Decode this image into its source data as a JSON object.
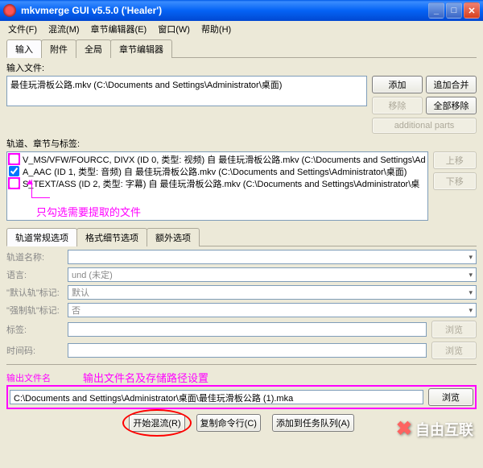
{
  "window": {
    "title": "mkvmerge GUI v5.5.0 ('Healer')"
  },
  "menu": {
    "file": "文件(F)",
    "mux": "混流(M)",
    "chaptereditor": "章节编辑器(E)",
    "window": "窗口(W)",
    "help": "帮助(H)"
  },
  "maintabs": {
    "input": "输入",
    "attach": "附件",
    "global": "全局",
    "chapter": "章节编辑器"
  },
  "input": {
    "files_label": "输入文件:",
    "file0": "最佳玩滑板公路.mkv (C:\\Documents and Settings\\Administrator\\桌面)",
    "btn_add": "添加",
    "btn_append": "追加合并",
    "btn_remove": "移除",
    "btn_removeall": "全部移除",
    "btn_additional": "additional parts",
    "tracks_label": "轨道、章节与标签:",
    "track0": "V_MS/VFW/FOURCC, DIVX (ID 0, 类型: 视频) 自 最佳玩滑板公路.mkv (C:\\Documents and Settings\\Ad",
    "track1": "A_AAC (ID 1, 类型: 音频) 自 最佳玩滑板公路.mkv (C:\\Documents and Settings\\Administrator\\桌面)",
    "track2": "S_TEXT/ASS (ID 2, 类型: 字幕) 自 最佳玩滑板公路.mkv (C:\\Documents and Settings\\Administrator\\桌",
    "btn_up": "上移",
    "btn_down": "下移",
    "annotation1": "只勾选需要提取的文件"
  },
  "subtabs": {
    "general": "轨道常规选项",
    "format": "格式细节选项",
    "extra": "额外选项"
  },
  "fields": {
    "trackname_label": "轨道名称:",
    "trackname_val": "",
    "language_label": "语言:",
    "language_val": "und (未定)",
    "default_label": "\"默认轨\"标记:",
    "default_val": "默认",
    "forced_label": "\"强制轨\"标记:",
    "forced_val": "否",
    "tags_label": "标签:",
    "tags_val": "",
    "timecodes_label": "时间码:",
    "timecodes_val": "",
    "browse": "浏览"
  },
  "output": {
    "label": "输出文件名",
    "annotation": "输出文件名及存储路径设置",
    "path": "C:\\Documents and Settings\\Administrator\\桌面\\最佳玩滑板公路 (1).mka",
    "browse": "浏览"
  },
  "footer": {
    "start": "开始混流(R)",
    "copy": "复制命令行(C)",
    "queue": "添加到任务队列(A)"
  },
  "watermark": "自由互联"
}
